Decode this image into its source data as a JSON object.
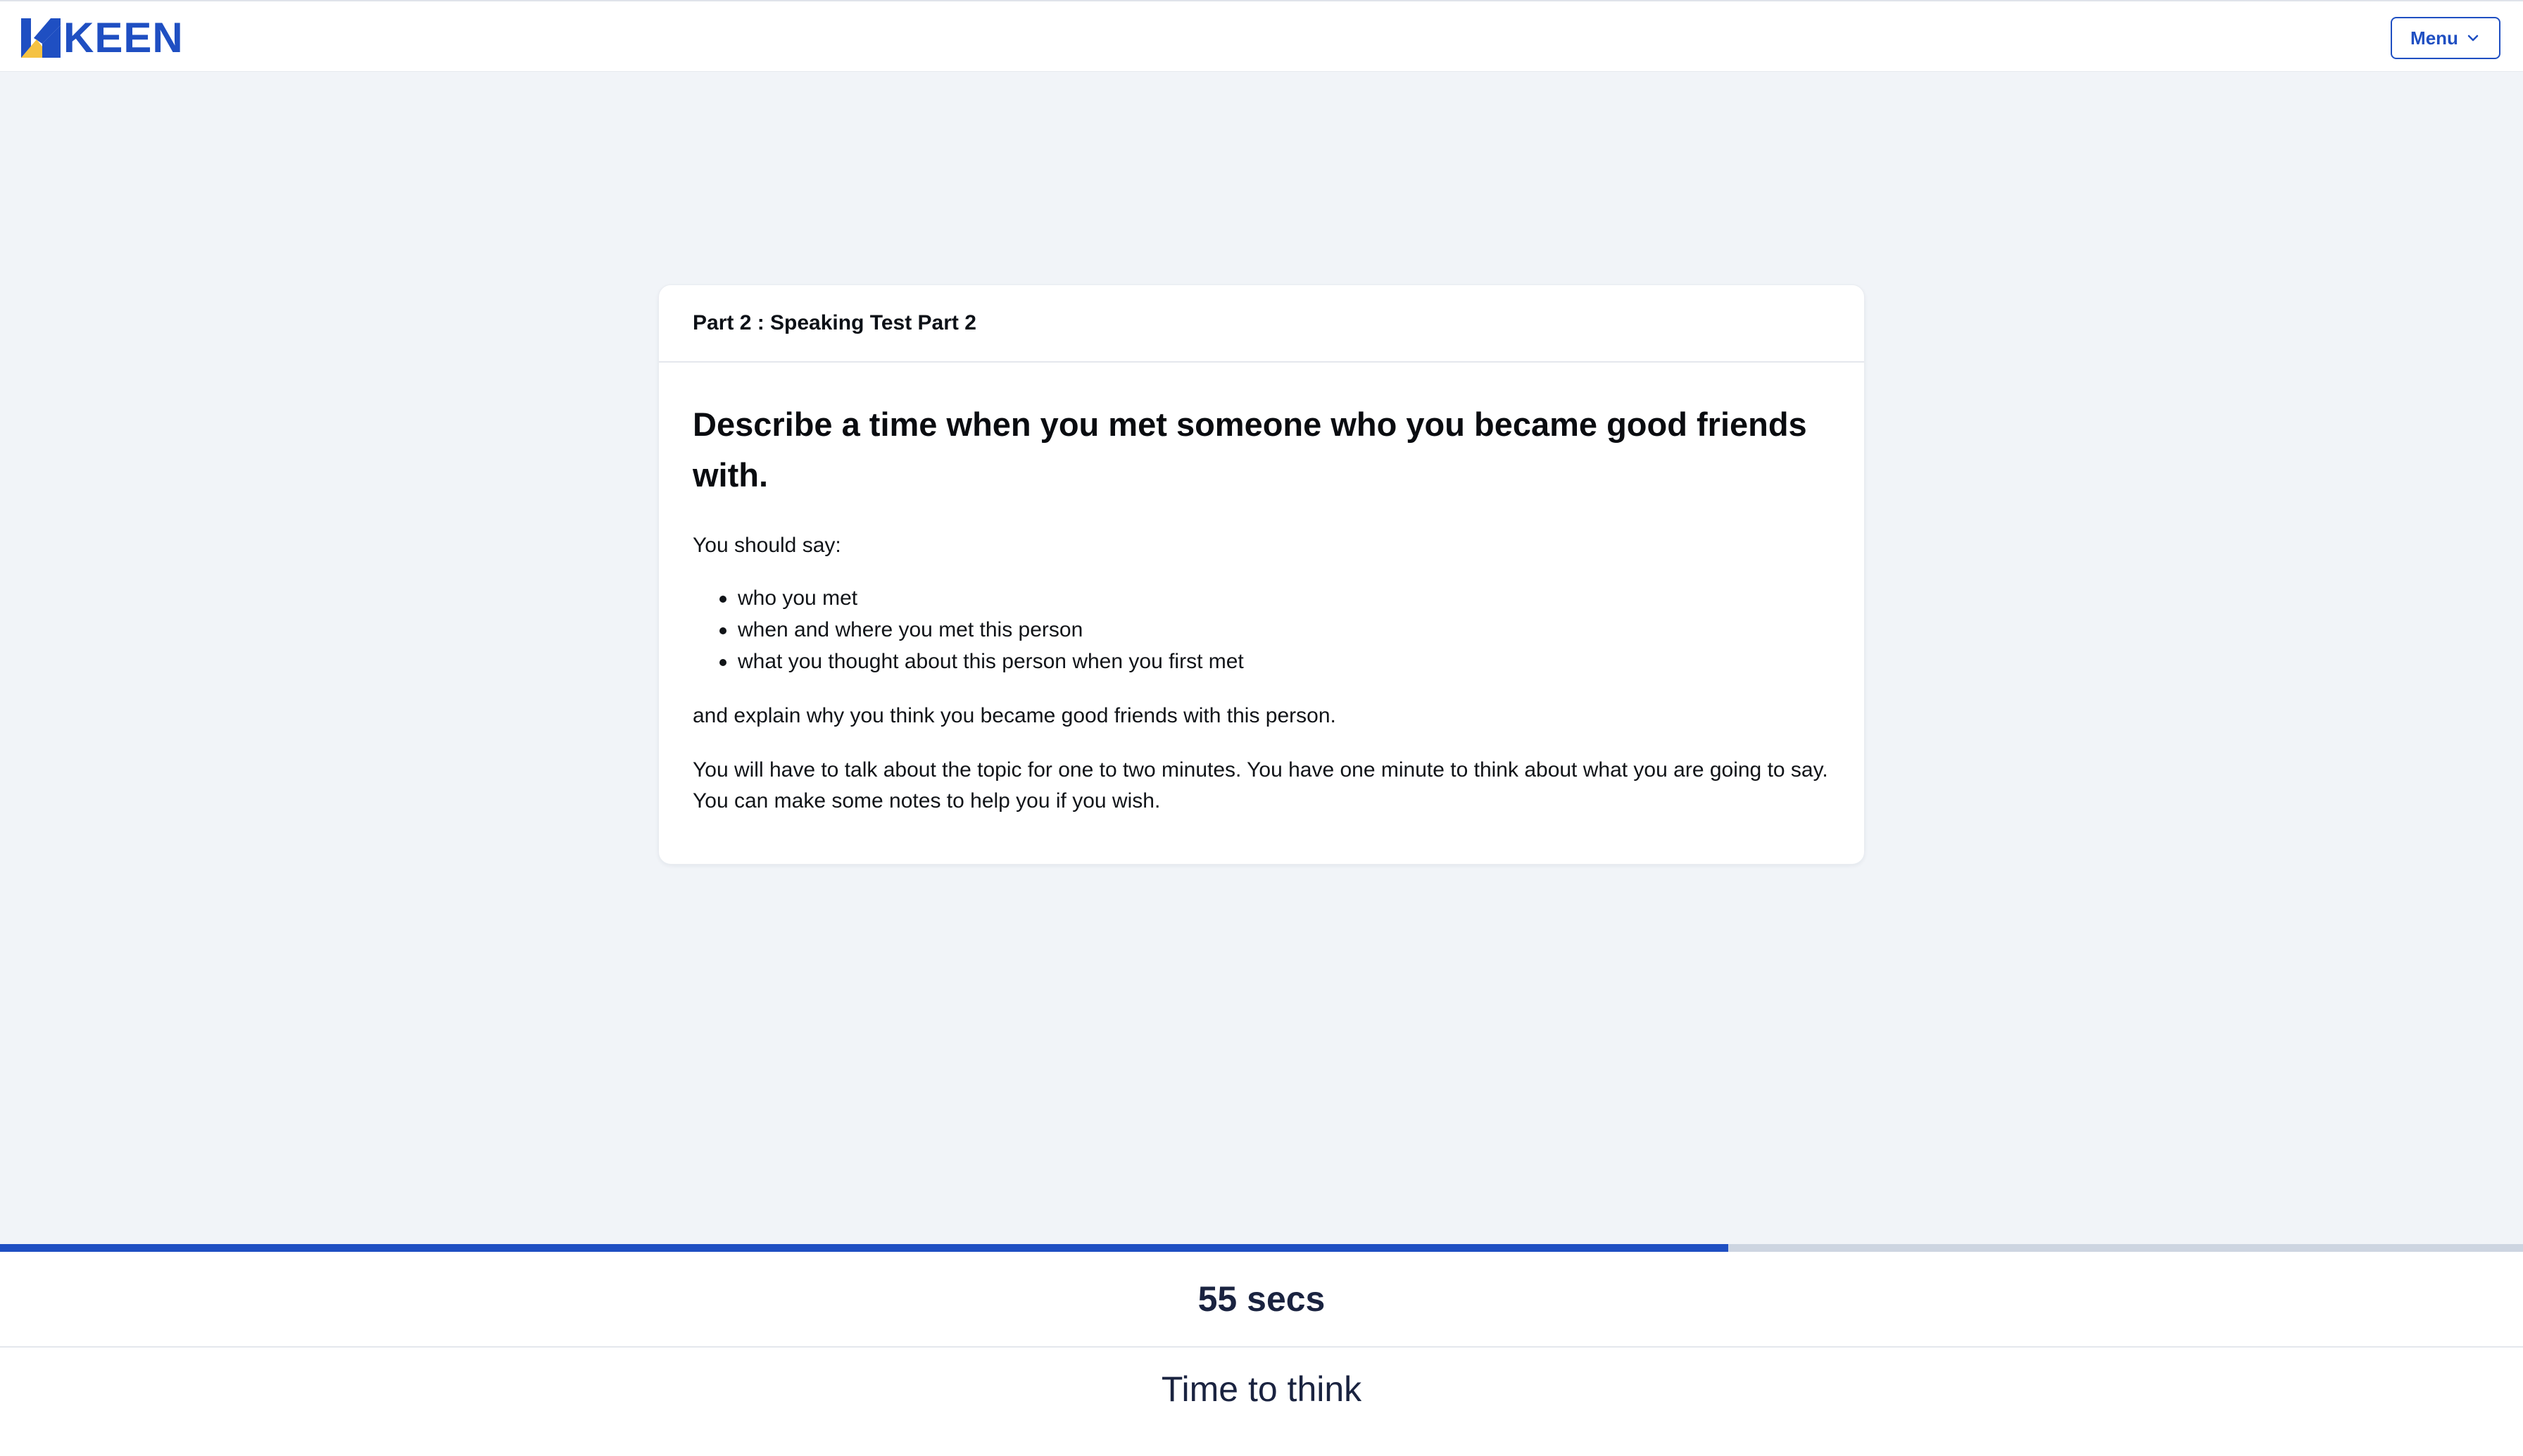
{
  "header": {
    "logo_text": "KEEN",
    "menu_label": "Menu",
    "brand_color": "#1f4fc2",
    "logo_accent_color": "#f5c242"
  },
  "card": {
    "header_title": "Part 2 : Speaking Test Part 2",
    "question": "Describe a time when you met someone who you became good friends with.",
    "intro": "You should say:",
    "bullets": [
      "who you met",
      "when and where you met this person",
      "what you thought about this person when you first met"
    ],
    "explain": "and explain why you think you became good friends with this person.",
    "instructions": "You will have to talk about the topic for one to two minutes. You have one minute to think about what you are going to say. You can make some notes to help you if you wish."
  },
  "timer": {
    "progress_fraction": 0.685,
    "remaining": "55 secs",
    "phase_label": "Time to think"
  },
  "icons": {
    "logo": "keen-logo-icon",
    "menu_chevron": "chevron-down-icon"
  }
}
